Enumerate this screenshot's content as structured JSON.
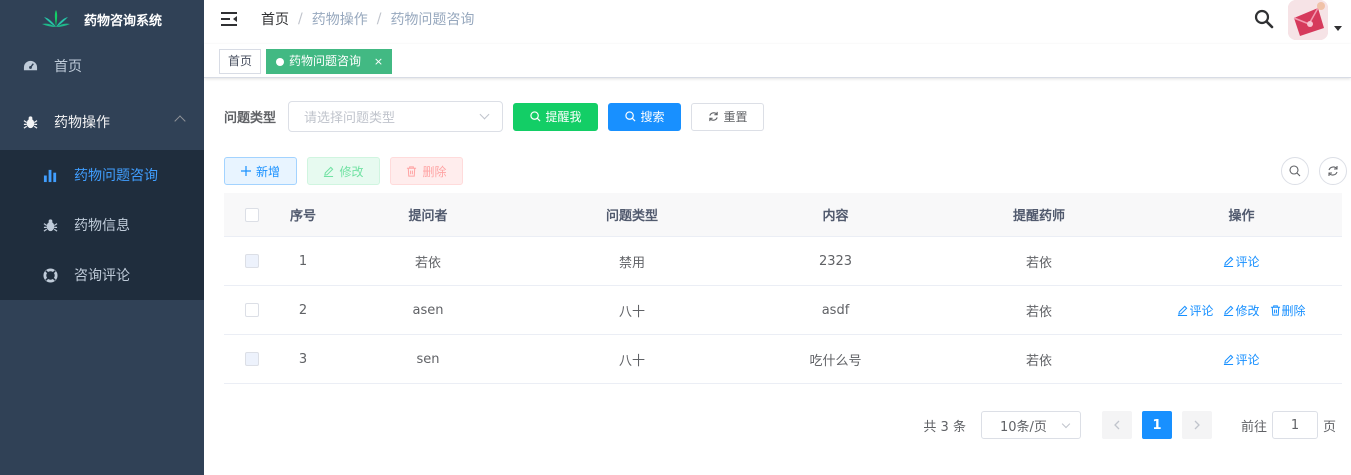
{
  "sidebar": {
    "logo_title": "药物咨询系统",
    "items": [
      {
        "label": "首页",
        "icon": "dashboard-icon"
      },
      {
        "label": "药物操作",
        "icon": "bug-icon",
        "expanded": true
      }
    ],
    "subitems": [
      {
        "label": "药物问题咨询",
        "icon": "bar-chart-icon",
        "active": true
      },
      {
        "label": "药物信息",
        "icon": "bug-icon"
      },
      {
        "label": "咨询评论",
        "icon": "lifebuoy-icon"
      }
    ]
  },
  "navbar": {
    "breadcrumb": [
      "首页",
      "药物操作",
      "药物问题咨询"
    ],
    "separator": "/"
  },
  "tags": [
    {
      "label": "首页",
      "active": false
    },
    {
      "label": "药物问题咨询",
      "active": true,
      "close": "×"
    }
  ],
  "search": {
    "label": "问题类型",
    "placeholder": "请选择问题类型",
    "remind_button": "提醒我",
    "search_button": "搜索",
    "reset_button": "重置"
  },
  "toolbar": {
    "add_button": "新增",
    "edit_button": "修改",
    "delete_button": "删除"
  },
  "table": {
    "columns": [
      "序号",
      "提问者",
      "问题类型",
      "内容",
      "提醒药师",
      "操作"
    ],
    "rows": [
      {
        "no": "1",
        "asker": "若依",
        "type": "禁用",
        "content": "2323",
        "pharmacist": "若依",
        "actions": [
          "评论"
        ]
      },
      {
        "no": "2",
        "asker": "asen",
        "type": "八十",
        "content": "asdf",
        "pharmacist": "若依",
        "actions": [
          "评论",
          "修改",
          "删除"
        ]
      },
      {
        "no": "3",
        "asker": "sen",
        "type": "八十",
        "content": "吃什么号",
        "pharmacist": "若依",
        "actions": [
          "评论"
        ]
      }
    ]
  },
  "pagination": {
    "total_text": "共 3 条",
    "page_size": "10条/页",
    "current_page": "1",
    "goto_label": "前往",
    "goto_value": "1",
    "page_suffix": "页"
  },
  "colors": {
    "sidebar_bg": "#304156",
    "submenu_bg": "#1f2d3d",
    "active_menu": "#409eff",
    "tag_active": "#42b983",
    "primary": "#1890ff",
    "success": "#13ce66"
  }
}
